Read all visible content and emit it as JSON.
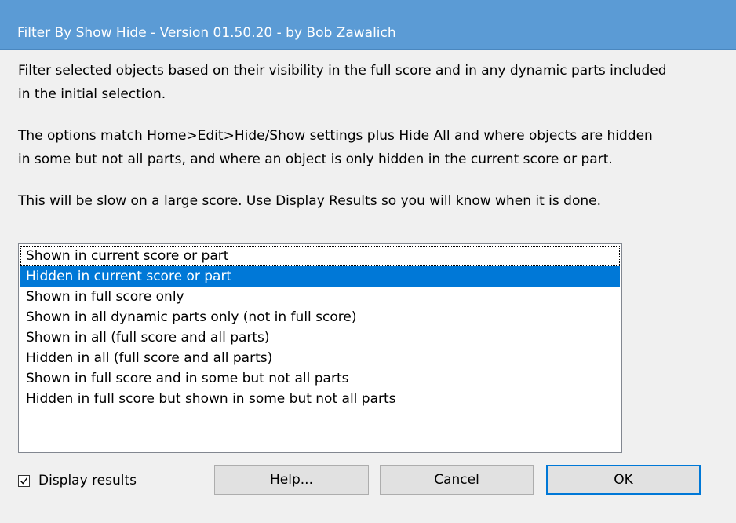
{
  "window": {
    "title": "Filter By Show Hide - Version 01.50.20 - by Bob Zawalich"
  },
  "description": {
    "paragraph1_line1": "Filter selected objects based on their visibility in the full score and in any dynamic parts included",
    "paragraph1_line2": "in the initial selection.",
    "paragraph2_line1": "The options match Home>Edit>Hide/Show settings plus Hide All and where objects are hidden",
    "paragraph2_line2": "in some but not all parts, and where an object is only hidden in the current score or part.",
    "paragraph3_line1": "This will be slow on a large score. Use Display Results so you will know when it is done."
  },
  "options_list": {
    "items": [
      {
        "label": "Shown in current score or part",
        "focused": true,
        "selected": false
      },
      {
        "label": "Hidden in current score or part",
        "focused": false,
        "selected": true
      },
      {
        "label": "Shown in full score only",
        "focused": false,
        "selected": false
      },
      {
        "label": "Shown in all dynamic parts only (not in full score)",
        "focused": false,
        "selected": false
      },
      {
        "label": "Shown in all (full score and all parts)",
        "focused": false,
        "selected": false
      },
      {
        "label": "Hidden in all (full score and all parts)",
        "focused": false,
        "selected": false
      },
      {
        "label": "Shown in full score and in some but not all parts",
        "focused": false,
        "selected": false
      },
      {
        "label": "Hidden in full score but shown in some but not all parts",
        "focused": false,
        "selected": false
      }
    ]
  },
  "display_results": {
    "label": "Display results",
    "checked": true
  },
  "buttons": {
    "help_label": "Help...",
    "cancel_label": "Cancel",
    "ok_label": "OK"
  },
  "colors": {
    "titlebar": "#5b9bd5",
    "selection": "#0078d7",
    "dialog_background": "#f0f0f0"
  }
}
